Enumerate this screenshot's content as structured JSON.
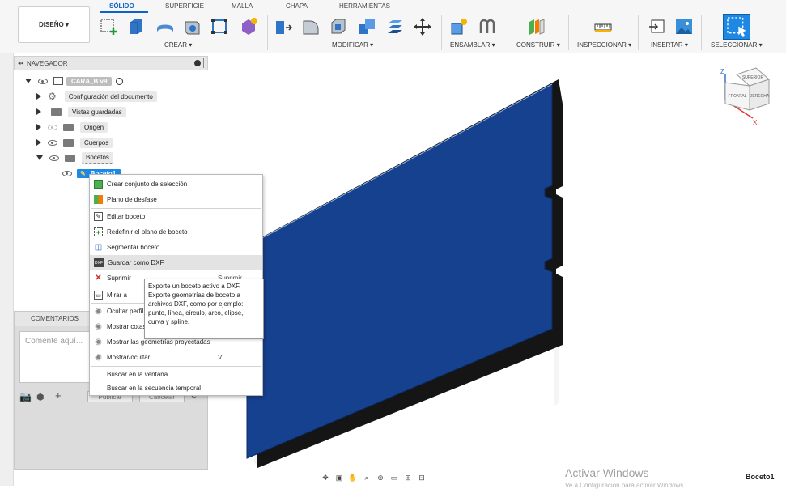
{
  "workspace": {
    "label": "DISEÑO ▾"
  },
  "tabs": [
    "SÓLIDO",
    "SUPERFICIE",
    "MALLA",
    "CHAPA",
    "HERRAMIENTAS"
  ],
  "toolbar_groups": {
    "crear": "CREAR ▾",
    "modificar": "MODIFICAR ▾",
    "ensamblar": "ENSAMBLAR ▾",
    "construir": "CONSTRUIR ▾",
    "inspeccionar": "INSPECCIONAR ▾",
    "insertar": "INSERTAR ▾",
    "seleccionar": "SELECCIONAR ▾"
  },
  "navigator": {
    "title": "NAVEGADOR",
    "root": "CARA_B v9",
    "items": [
      "Configuración del documento",
      "Vistas guardadas",
      "Origen",
      "Cuerpos",
      "Bocetos"
    ],
    "selected_sketch": "Boceto1"
  },
  "comments": {
    "title": "COMENTARIOS",
    "placeholder": "Comente aquí...",
    "publish": "Publicar",
    "cancel": "Cancelar"
  },
  "context_menu": {
    "items": [
      {
        "label": "Crear conjunto de selección",
        "shortcut": ""
      },
      {
        "label": "Plano de desfase",
        "shortcut": ""
      },
      {
        "label": "Editar boceto",
        "shortcut": ""
      },
      {
        "label": "Redefinir el plano de boceto",
        "shortcut": ""
      },
      {
        "label": "Segmentar boceto",
        "shortcut": ""
      },
      {
        "label": "Guardar como DXF",
        "shortcut": ""
      },
      {
        "label": "Suprimir",
        "shortcut": "Suprimir"
      },
      {
        "label": "Mirar a",
        "shortcut": ""
      },
      {
        "label": "Ocultar perfil",
        "shortcut": ""
      },
      {
        "label": "Mostrar cotas",
        "shortcut": ""
      },
      {
        "label": "Mostrar las geometrías proyectadas",
        "shortcut": ""
      },
      {
        "label": "Mostrar/ocultar",
        "shortcut": "V"
      },
      {
        "label": "Buscar en la ventana",
        "shortcut": ""
      },
      {
        "label": "Buscar en la secuencia temporal",
        "shortcut": ""
      }
    ]
  },
  "tooltip": {
    "lines": [
      "Exporte un boceto activo a DXF.",
      "Exporte geometrías de boceto a",
      "archivos DXF, como por ejemplo:",
      "punto, línea, círculo, arco, elipse,",
      "curva y spline."
    ]
  },
  "viewcube": {
    "top": "SUPERIOR",
    "front": "FRONTAL",
    "right": "DERECHA",
    "axis_z": "Z",
    "axis_x": "X"
  },
  "watermark": {
    "title": "Activar Windows",
    "subtitle": "Ve a Configuración para activar Windows."
  },
  "status": {
    "active_sketch": "Boceto1"
  },
  "colors": {
    "accent": "#0a63c5",
    "plate": "#16418f",
    "selection": "#1e88e5"
  }
}
